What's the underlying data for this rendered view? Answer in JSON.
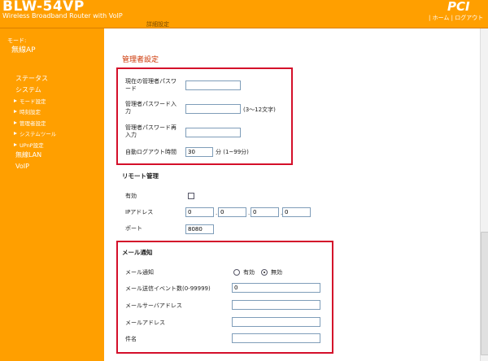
{
  "header": {
    "model": "BLW-54VP",
    "subtitle": "Wireless Broadband Router with VoIP",
    "brand": "PCI",
    "home_link": "ホーム",
    "logout_link": "ログアウト",
    "separator": "|",
    "breadcrumb": "詳細設定"
  },
  "sidebar": {
    "mode_label": "モード:",
    "mode_value": "無線AP",
    "items": [
      {
        "label": "ステータス"
      },
      {
        "label": "システム"
      },
      {
        "label": "モード設定"
      },
      {
        "label": "時刻設定"
      },
      {
        "label": "管理者設定"
      },
      {
        "label": "システムツール"
      },
      {
        "label": "UPnP設定"
      },
      {
        "label": "無線LAN"
      },
      {
        "label": "VoIP"
      }
    ]
  },
  "admin": {
    "title": "管理者設定",
    "current_pw_label": "現在の管理者パスワ\nード",
    "new_pw_label": "管理者パスワード入\n力",
    "new_pw_hint": "(3～12文字)",
    "confirm_pw_label": "管理者パスワード再\n入力",
    "auto_logout_label": "自動ログアウト時間",
    "auto_logout_value": "30",
    "auto_logout_unit": "分 (1~99分)"
  },
  "remote": {
    "title": "リモート管理",
    "enable_label": "有効",
    "ip_label": "IPアドレス",
    "ip": [
      "0",
      "0",
      "0",
      "0"
    ],
    "port_label": "ポート",
    "port_value": "8080"
  },
  "mail": {
    "title": "メール通知",
    "notify_label": "メール通知",
    "opt_enable": "有効",
    "opt_disable": "無効",
    "selected": "無効",
    "event_count_label": "メール送信イベント数(0-99999)",
    "event_count_value": "0",
    "server_label": "メールサーバアドレス",
    "address_label": "メールアドレス",
    "subject_label": "件名"
  },
  "colors": {
    "orange": "#ff9f00",
    "highlight": "#d40f2a",
    "section_title": "#cc3300"
  }
}
